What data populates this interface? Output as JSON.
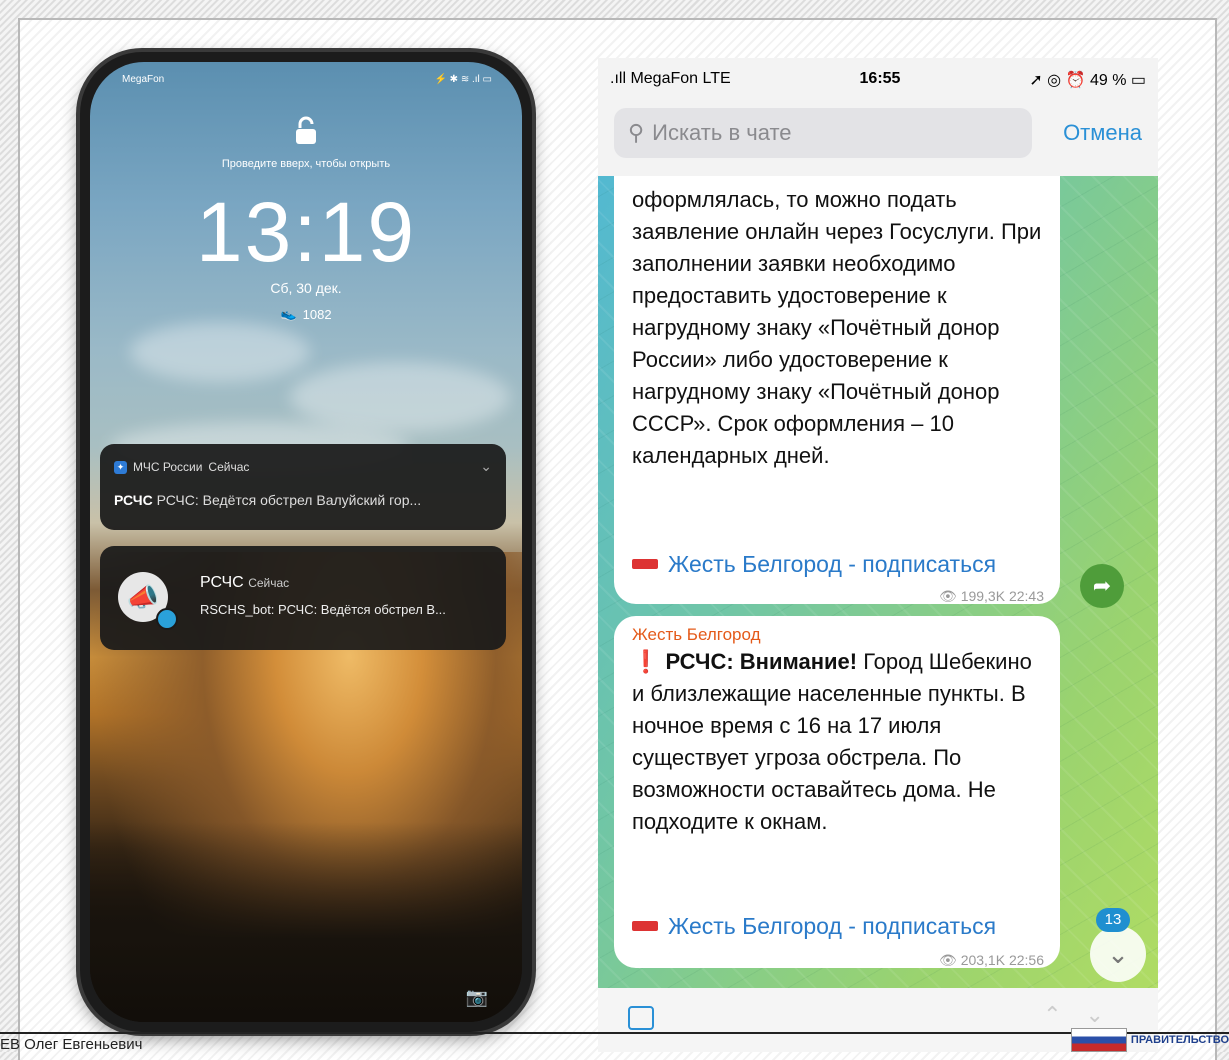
{
  "lockscreen": {
    "carrier": "MegaFon",
    "swipe_hint": "Проведите вверх, чтобы открыть",
    "time": "13:19",
    "date": "Сб, 30 дек.",
    "steps": "1082",
    "notification1": {
      "app": "МЧС России",
      "when": "Сейчас",
      "sender": "РСЧС",
      "text": "РСЧС: Ведётся обстрел Валуйский гор..."
    },
    "notification2": {
      "title": "РСЧС",
      "when": "Сейчас",
      "sender": "RSCHS_bot:",
      "text": "РСЧС: Ведётся обстрел В..."
    }
  },
  "telegram": {
    "status": {
      "signal": "MegaFon  LTE",
      "time": "16:55",
      "battery": "49 %"
    },
    "search_placeholder": "Искать в чате",
    "cancel_label": "Отмена",
    "message1": {
      "text": "оформлялась, то можно подать заявление онлайн через Госуслуги. При заполнении заявки необходимо предоставить удостоверение к нагрудному знаку «Почётный донор России» либо удостоверение к нагрудному знаку «Почётный донор СССР». Срок оформления – 10 календарных дней.",
      "subscribe": "Жесть Белгород - подписаться",
      "views": "199,3K",
      "time": "22:43"
    },
    "message2": {
      "sender": "Жесть Белгород",
      "alert_prefix": "РСЧС: Внимание!",
      "text": " Город Шебекино и близлежащие населенные пункты. В ночное время с 16 на 17 июля существует угроза обстрела. По возможности оставайтесь дома. Не подходите к окнам.",
      "subscribe": "Жесть Белгород - подписаться",
      "views": "203,1K",
      "time": "22:56"
    },
    "unread_count": "13"
  },
  "footer": {
    "name": "ЕВ Олег Евгеньевич",
    "gov_label": "ПРАВИТЕЛЬСТВО"
  }
}
